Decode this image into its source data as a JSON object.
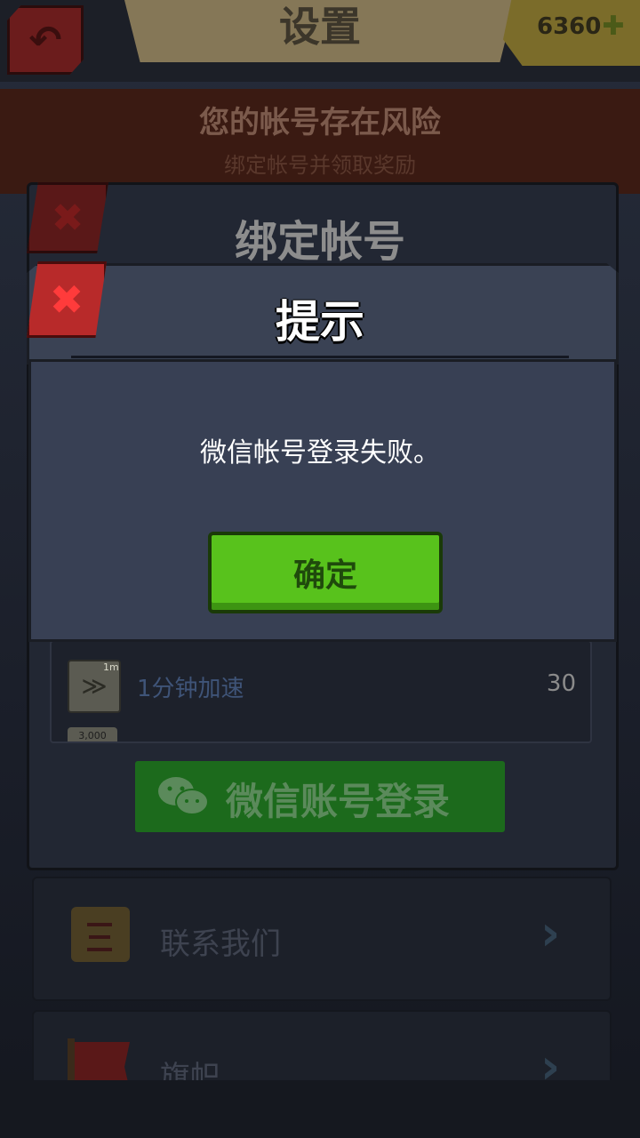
{
  "header": {
    "title": "设置",
    "back_icon": "back-arrow-icon",
    "gem_count": "6360",
    "gem_icon": "gem-plus-icon"
  },
  "risk_banner": {
    "title": "您的帐号存在风险",
    "subtitle": "绑定帐号并领取奖励"
  },
  "bind_panel": {
    "title": "绑定帐号",
    "close_icon": "close-icon",
    "rewards": [
      {
        "icon": "speedup-icon",
        "badge": "1m",
        "name": "1分钟加速",
        "value": "30"
      },
      {
        "icon": "gold-icon",
        "badge": "3,000"
      }
    ],
    "wechat_button": {
      "icon": "wechat-icon",
      "label": "微信账号登录"
    }
  },
  "menu": {
    "items": [
      {
        "icon": "scroll-icon",
        "label": "联系我们",
        "chevron": "›"
      },
      {
        "icon": "flag-icon",
        "label": "旗帜",
        "chevron": "›"
      }
    ]
  },
  "dialog": {
    "title": "提示",
    "message": "微信帐号登录失败。",
    "ok_label": "确定",
    "close_icon": "close-icon"
  },
  "colors": {
    "ok_green": "#58c21c",
    "close_red": "#b82a2a",
    "wechat_green": "#1c6a1c"
  }
}
